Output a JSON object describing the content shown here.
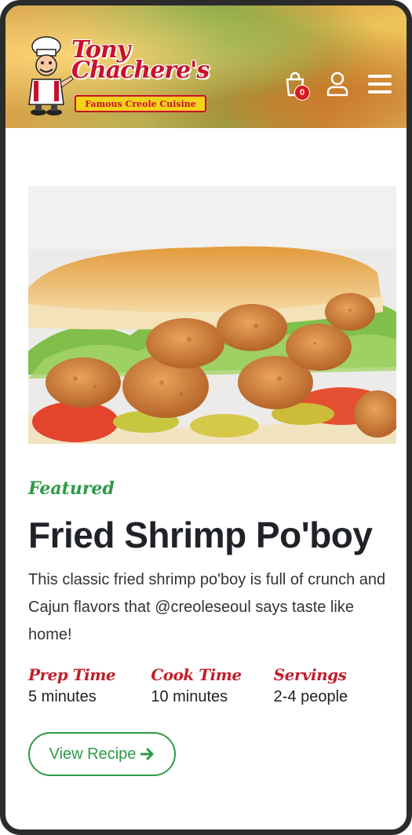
{
  "header": {
    "logo": {
      "name": "Tony Chachere's",
      "tagline": "Famous Creole Cuisine"
    },
    "cart": {
      "count": "0",
      "icon": "shopping-bag-icon"
    },
    "account_icon": "user-icon",
    "menu_icon": "hamburger-menu-icon"
  },
  "feature": {
    "image_alt": "Fried shrimp po'boy sandwich with lettuce, tomato and pickles",
    "tag": "Featured",
    "title": "Fried Shrimp Po'boy",
    "description": "This classic fried shrimp po'boy is full of crunch and Cajun flavors that @creoleseoul says taste like home!",
    "meta": [
      {
        "label": "Prep Time",
        "value": "5 minutes"
      },
      {
        "label": "Cook Time",
        "value": "10 minutes"
      },
      {
        "label": "Servings",
        "value": "2-4 people"
      }
    ],
    "button_label": "View Recipe"
  },
  "colors": {
    "brand_red": "#c8102e",
    "accent_green": "#2d9a47",
    "badge_red": "#d71920",
    "title_dark": "#1f2328"
  }
}
